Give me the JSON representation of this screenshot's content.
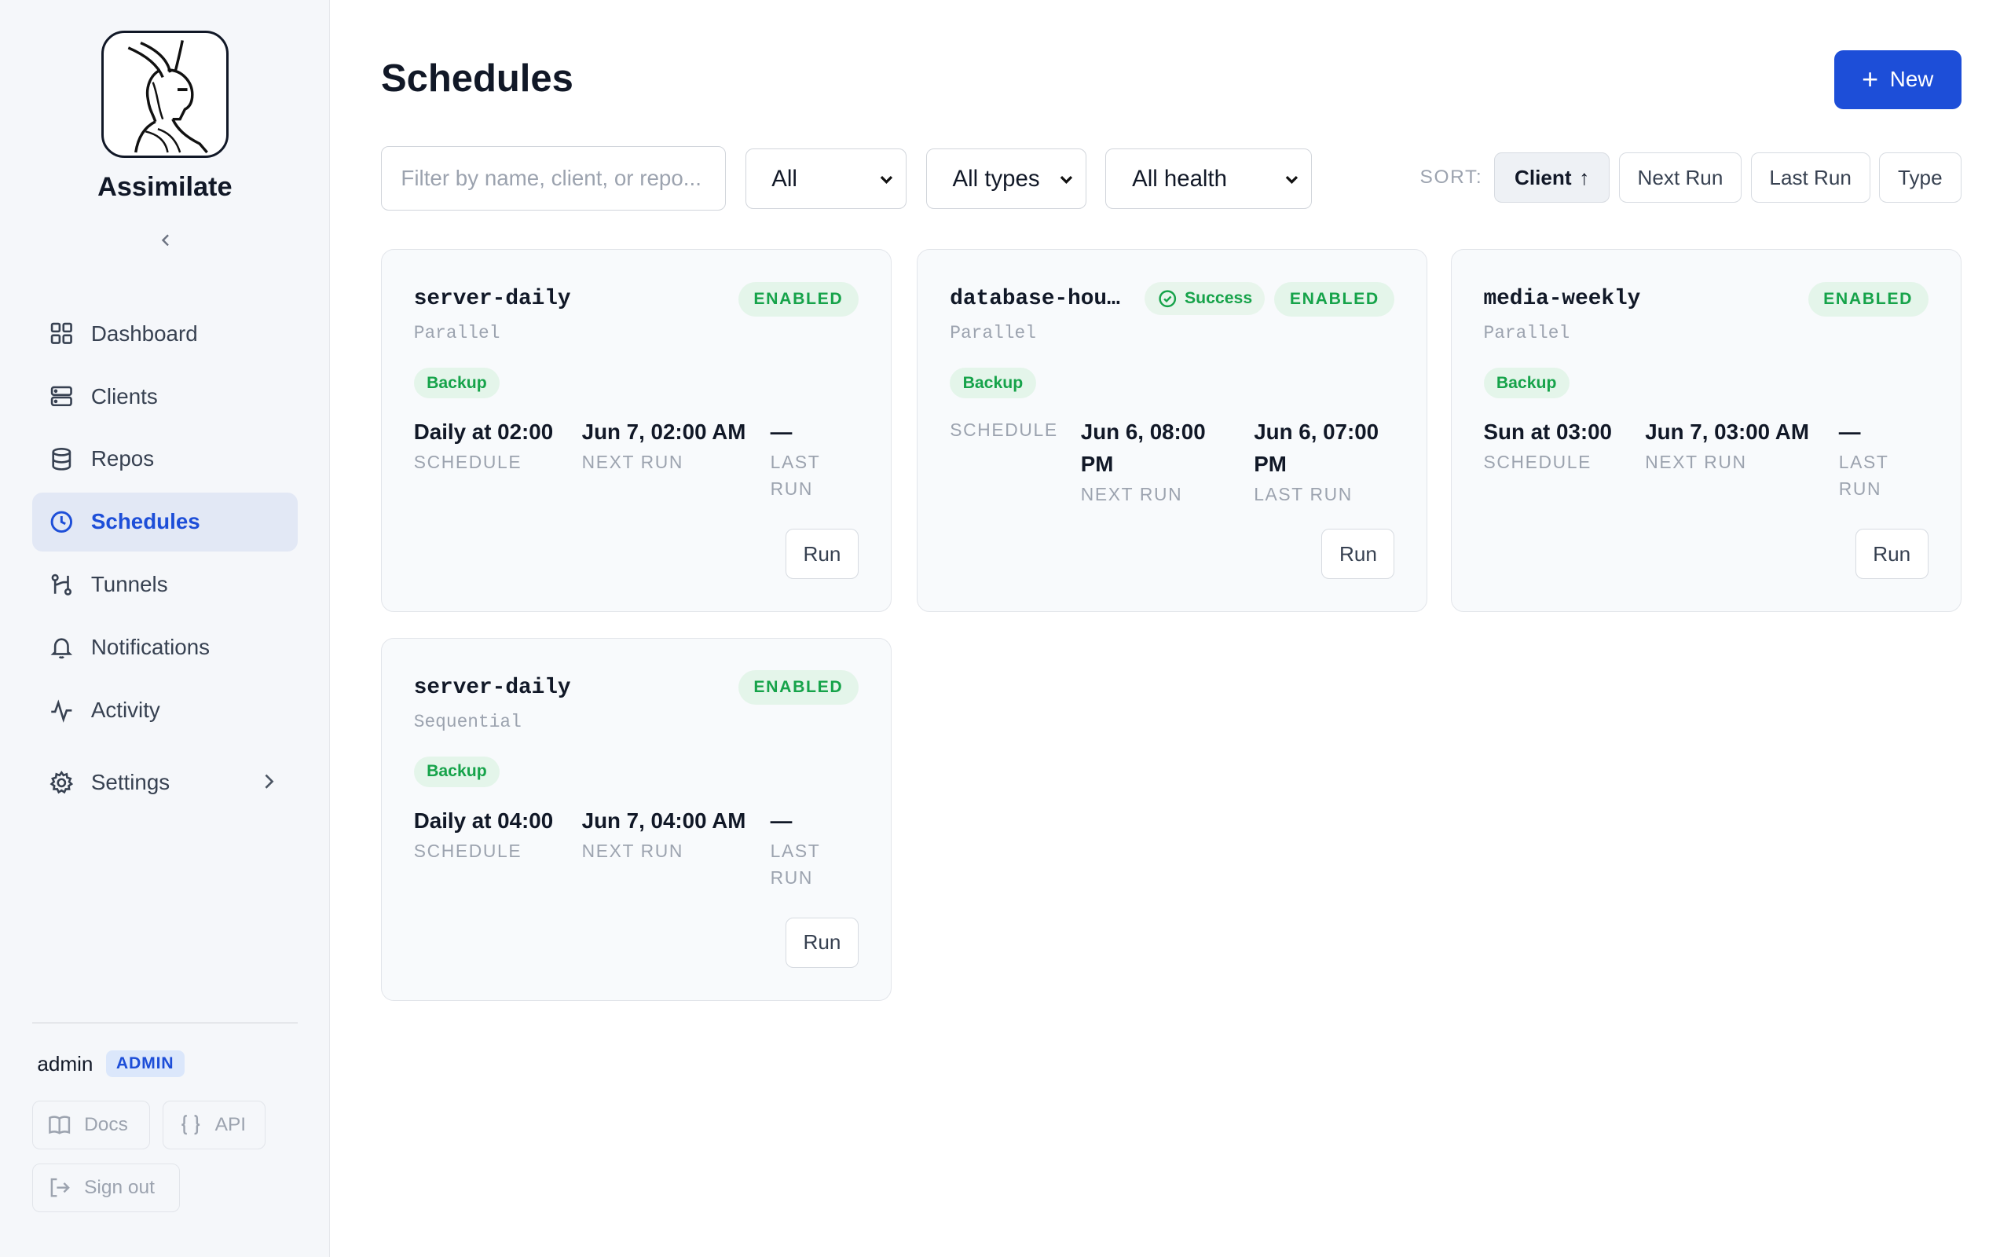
{
  "app": {
    "brand": "Assimilate"
  },
  "sidebar": {
    "items": [
      {
        "label": "Dashboard",
        "icon": "grid-icon"
      },
      {
        "label": "Clients",
        "icon": "server-icon"
      },
      {
        "label": "Repos",
        "icon": "database-icon"
      },
      {
        "label": "Schedules",
        "icon": "clock-icon",
        "active": true
      },
      {
        "label": "Tunnels",
        "icon": "tunnel-icon"
      },
      {
        "label": "Notifications",
        "icon": "bell-icon"
      },
      {
        "label": "Activity",
        "icon": "activity-icon"
      },
      {
        "label": "Settings",
        "icon": "gear-icon"
      }
    ],
    "user": {
      "name": "admin",
      "role": "ADMIN"
    },
    "docs_label": "Docs",
    "api_label": "API",
    "signout_label": "Sign out"
  },
  "page": {
    "title": "Schedules",
    "new_label": "New",
    "filter_placeholder": "Filter by name, client, or repo...",
    "filters": {
      "status": "All",
      "type": "All types",
      "health": "All health"
    },
    "sort": {
      "label": "SORT:",
      "options": [
        "Client",
        "Next Run",
        "Last Run",
        "Type"
      ],
      "active": "Client",
      "arrow": "↑"
    }
  },
  "labels": {
    "schedule": "SCHEDULE",
    "next_run": "NEXT RUN",
    "last_run": "LAST RUN",
    "run": "Run"
  },
  "cards": [
    {
      "name": "server-daily",
      "mode": "Parallel",
      "status": "ENABLED",
      "type": "Backup",
      "schedule": "Daily at 02:00",
      "next_run": "Jun 7, 02:00 AM",
      "last_run": "—"
    },
    {
      "name": "database-hou…",
      "mode": "Parallel",
      "status": "ENABLED",
      "health": "Success",
      "type": "Backup",
      "schedule": "",
      "next_run": "Jun 6, 08:00 PM",
      "last_run": "Jun 6, 07:00 PM"
    },
    {
      "name": "media-weekly",
      "mode": "Parallel",
      "status": "ENABLED",
      "type": "Backup",
      "schedule": "Sun at 03:00",
      "next_run": "Jun 7, 03:00 AM",
      "last_run": "—"
    },
    {
      "name": "server-daily",
      "mode": "Sequential",
      "status": "ENABLED",
      "type": "Backup",
      "schedule": "Daily at 04:00",
      "next_run": "Jun 7, 04:00 AM",
      "last_run": "—"
    }
  ],
  "colors": {
    "accent": "#1d4ed8",
    "success": "#16a34a",
    "sidebar_bg": "#f5f7fa"
  }
}
